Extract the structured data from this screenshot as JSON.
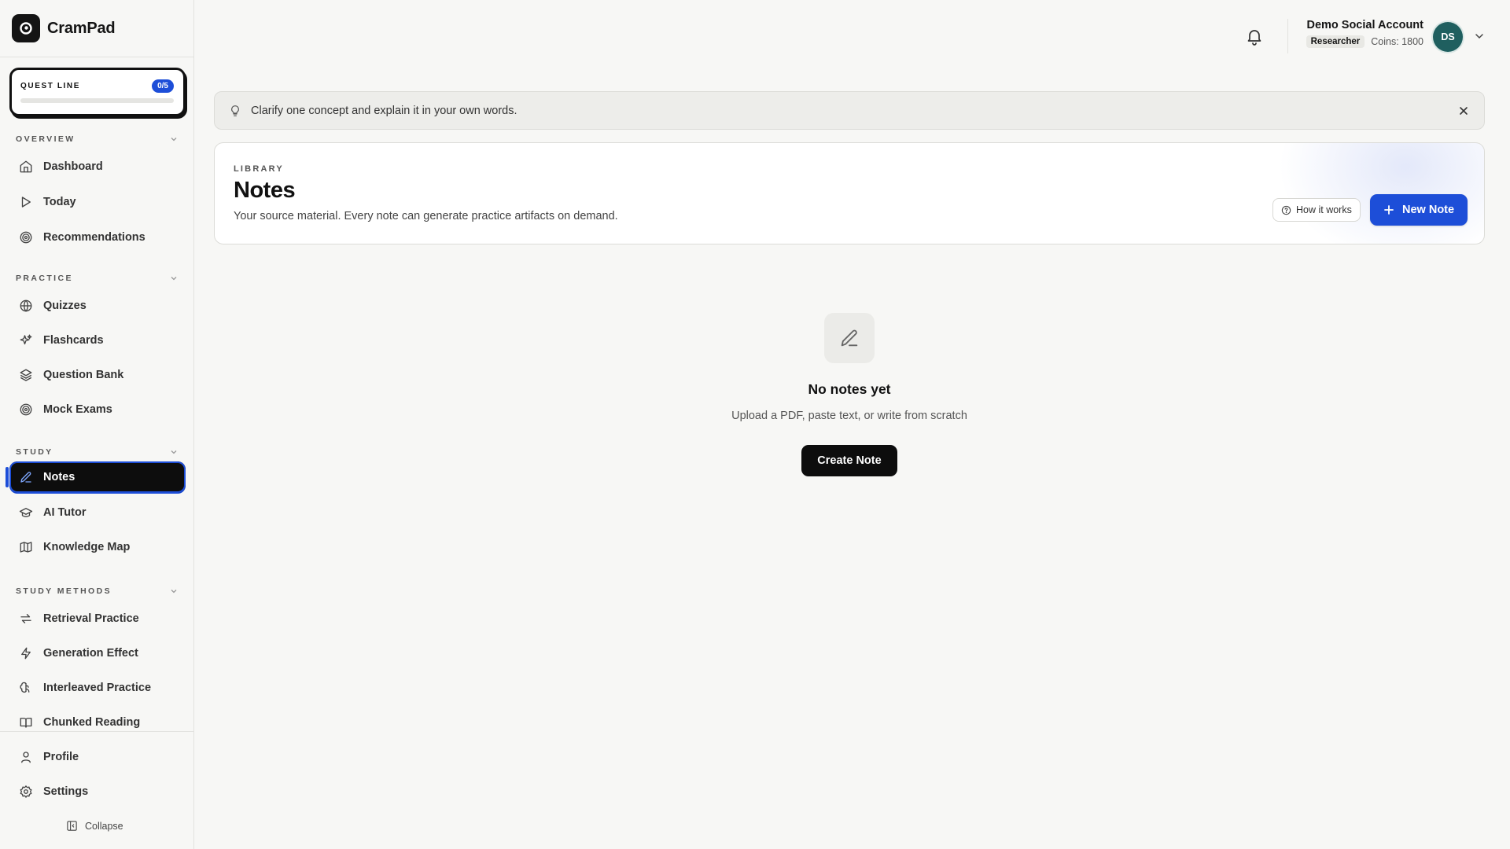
{
  "app": {
    "name": "CramPad"
  },
  "quest": {
    "label": "QUEST LINE",
    "progress_text": "0/5",
    "progress_fraction": 0
  },
  "sidebar": {
    "sections": [
      {
        "title": "OVERVIEW",
        "items": [
          {
            "label": "Dashboard",
            "icon": "home-icon"
          },
          {
            "label": "Today",
            "icon": "play-icon"
          },
          {
            "label": "Recommendations",
            "icon": "target-icon"
          }
        ]
      },
      {
        "title": "PRACTICE",
        "items": [
          {
            "label": "Quizzes",
            "icon": "globe-icon"
          },
          {
            "label": "Flashcards",
            "icon": "sparkles-icon"
          },
          {
            "label": "Question Bank",
            "icon": "layers-icon"
          },
          {
            "label": "Mock Exams",
            "icon": "target-icon"
          }
        ]
      },
      {
        "title": "STUDY",
        "items": [
          {
            "label": "Notes",
            "icon": "pencil-icon",
            "active": true
          },
          {
            "label": "AI Tutor",
            "icon": "graduation-cap-icon"
          },
          {
            "label": "Knowledge Map",
            "icon": "map-icon"
          }
        ]
      },
      {
        "title": "STUDY METHODS",
        "items": [
          {
            "label": "Retrieval Practice",
            "icon": "repeat-icon"
          },
          {
            "label": "Generation Effect",
            "icon": "zap-icon"
          },
          {
            "label": "Interleaved Practice",
            "icon": "brain-icon"
          },
          {
            "label": "Chunked Reading",
            "icon": "book-open-icon"
          }
        ]
      }
    ],
    "bottom": [
      {
        "label": "Profile",
        "icon": "user-icon"
      },
      {
        "label": "Settings",
        "icon": "gear-icon"
      }
    ],
    "collapse_label": "Collapse"
  },
  "header": {
    "account_name": "Demo Social Account",
    "role": "Researcher",
    "coins": "Coins: 1800",
    "avatar_initials": "DS"
  },
  "tip": {
    "text": "Clarify one concept and explain it in your own words."
  },
  "library": {
    "eyebrow": "LIBRARY",
    "title": "Notes",
    "subtitle": "Your source material. Every note can generate practice artifacts on demand.",
    "how_label": "How it works",
    "new_label": "New Note"
  },
  "empty": {
    "title": "No notes yet",
    "subtitle": "Upload a PDF, paste text, or write from scratch",
    "button": "Create Note"
  },
  "colors": {
    "accent": "#1d4ed8",
    "active_bg": "#0d0d0d",
    "avatar": "#1f5f5f",
    "background": "#f7f7f5"
  }
}
